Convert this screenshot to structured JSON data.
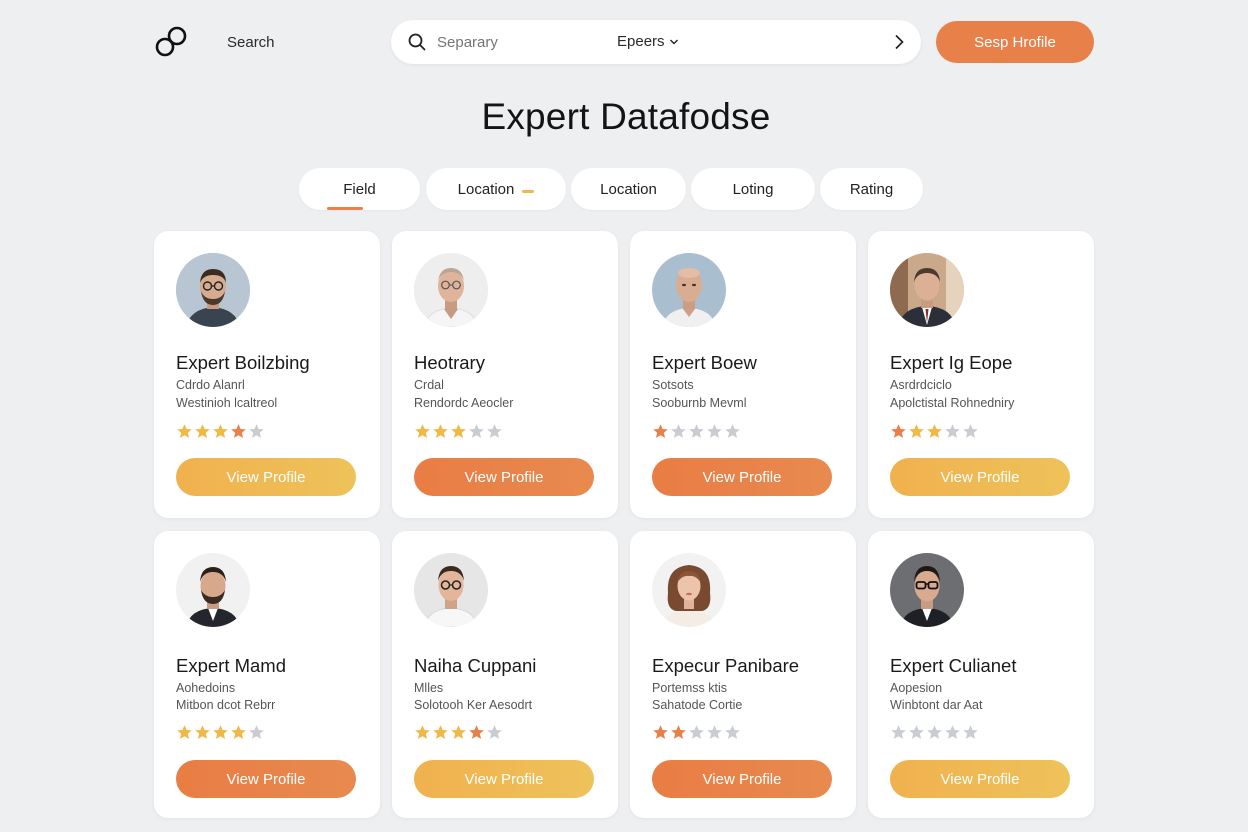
{
  "header": {
    "search_label": "Search",
    "search_placeholder": "Separary",
    "dropdown_label": "Epeers",
    "profile_button": "Sesp Hrofile"
  },
  "page_title": "Expert Datafodse",
  "tabs": [
    {
      "label": "Field",
      "active": true
    },
    {
      "label": "Location",
      "marker": true
    },
    {
      "label": "Location"
    },
    {
      "label": "Loting"
    },
    {
      "label": "Rating"
    }
  ],
  "colors": {
    "accent_orange": "#e8804a",
    "accent_yellow": "#f0b845",
    "star_grey": "#c9ccd1",
    "background": "#eeeff1"
  },
  "experts": [
    {
      "name": "Expert Boilzbing",
      "line1": "Cdrdo Alanrl",
      "line2": "Westinioh lcaltreol",
      "rating": 4,
      "star_style": "yellow-last-orange",
      "button": "View Profile",
      "button_color": "yellow",
      "avatar": "man-glasses-beard"
    },
    {
      "name": "Heotrary",
      "line1": "Crdal",
      "line2": "Rendordc Aeocler",
      "rating": 3,
      "star_style": "yellow",
      "button": "View Profile",
      "button_color": "orange",
      "avatar": "older-man-glasses"
    },
    {
      "name": "Expert Boew",
      "line1": "Sotsots",
      "line2": "Sooburnb Mevml",
      "rating": 1,
      "star_style": "orange",
      "button": "View Profile",
      "button_color": "orange",
      "avatar": "bald-man"
    },
    {
      "name": "Expert Ig Eope",
      "line1": "Asrdrdciclo",
      "line2": "Apolctistal Rohnedniry",
      "rating": 3,
      "star_style": "orange-yellow",
      "button": "View Profile",
      "button_color": "yellow",
      "avatar": "man-suit"
    },
    {
      "name": "Expert Mamd",
      "line1": "Aohedoins",
      "line2": "Mitbon dcot Rebrr",
      "rating": 4,
      "star_style": "yellow",
      "button": "View Profile",
      "button_color": "orange",
      "avatar": "man-beard-suit"
    },
    {
      "name": "Naiha Cuppani",
      "line1": "Mlles",
      "line2": "Solotooh Ker Aesodrt",
      "rating": 4,
      "star_style": "yellow-last-orange",
      "button": "View Profile",
      "button_color": "yellow",
      "avatar": "young-man-glasses"
    },
    {
      "name": "Expecur Panibare",
      "line1": "Portemss ktis",
      "line2": "Sahatode Cortie",
      "rating": 2,
      "star_style": "orange",
      "button": "View Profile",
      "button_color": "orange",
      "avatar": "woman-curly"
    },
    {
      "name": "Expert Culianet",
      "line1": "Aopesion",
      "line2": "Winbtont dar Aat",
      "rating": 0,
      "star_style": "none",
      "button": "View Profile",
      "button_color": "yellow",
      "avatar": "man-glasses-dark"
    }
  ]
}
